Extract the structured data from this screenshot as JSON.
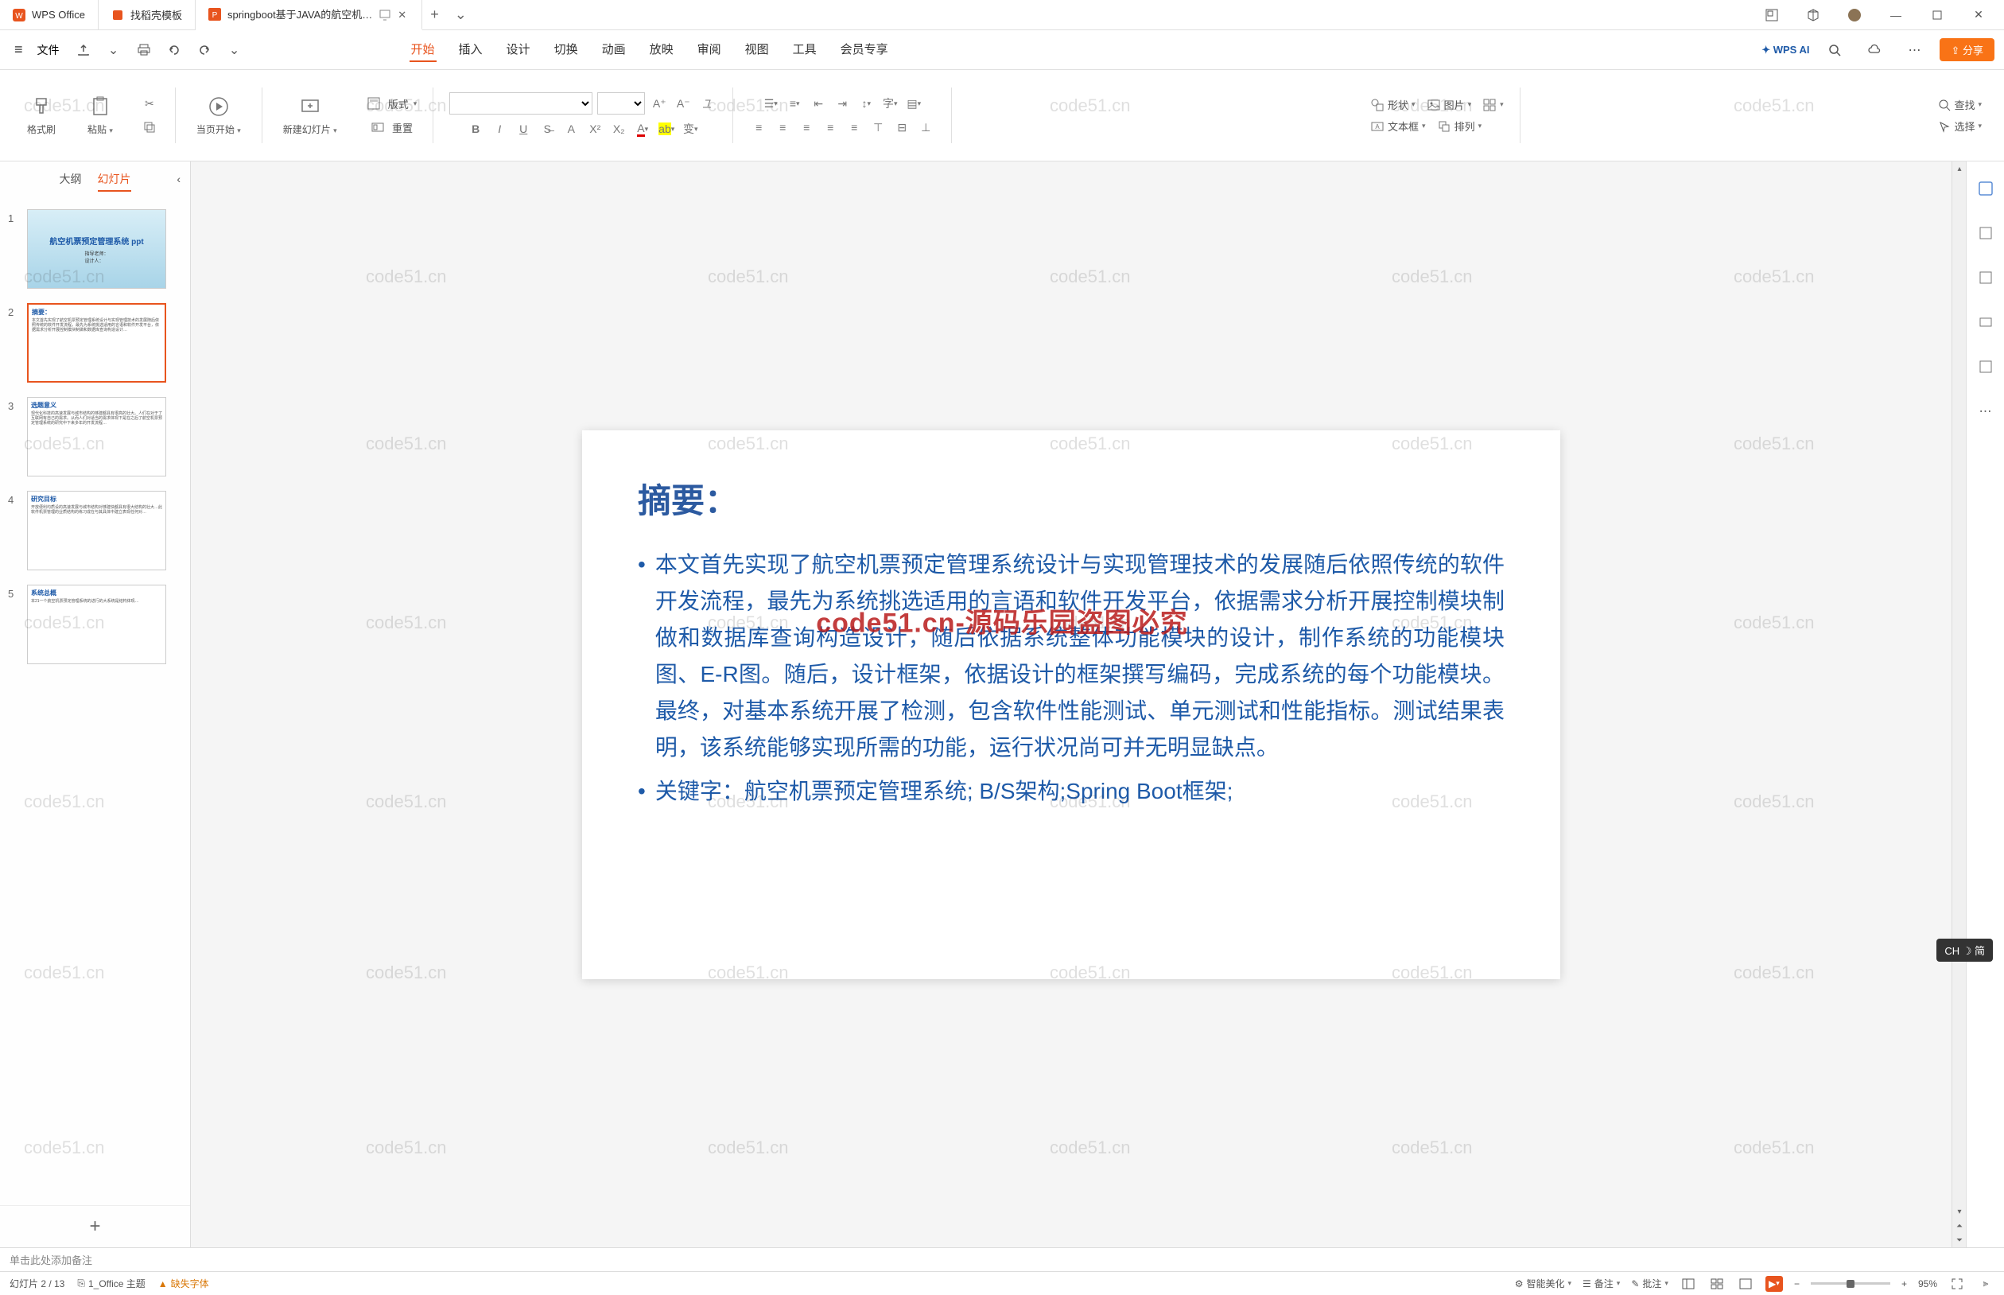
{
  "titlebar": {
    "app_name": "WPS Office",
    "tab1": "找稻壳模板",
    "tab2": "springboot基于JAVA的航空机…",
    "new_tab": "+",
    "dropdown": "⌄"
  },
  "menubar": {
    "file": "文件",
    "tabs": {
      "start": "开始",
      "insert": "插入",
      "design": "设计",
      "transition": "切换",
      "animation": "动画",
      "show": "放映",
      "review": "审阅",
      "view": "视图",
      "tools": "工具",
      "member": "会员专享"
    },
    "wps_ai": "WPS AI",
    "share": "分享"
  },
  "ribbon": {
    "format_painter": "格式刷",
    "paste": "粘贴",
    "from_current": "当页开始",
    "new_slide": "新建幻灯片",
    "layout": "版式",
    "reset": "重置",
    "shape": "形状",
    "picture": "图片",
    "textbox": "文本框",
    "arrange": "排列",
    "find": "查找",
    "select": "选择"
  },
  "sidebar": {
    "outline": "大纲",
    "slides": "幻灯片",
    "thumbs": [
      {
        "num": "1",
        "title": "航空机票预定管理系统 ppt",
        "sub": "指导老师：\n设计人："
      },
      {
        "num": "2",
        "title": "摘要：",
        "body": "本文首先实现了航空机票预定管理系统设计与实现管理技术的发展随后依照传统的软件开发流程，最先为系统挑选适用的言语和软件开发平台，依据需求分析开展控制模块制做和数据库查询构造设计…"
      },
      {
        "num": "3",
        "title": "选题意义",
        "body": ""
      },
      {
        "num": "4",
        "title": "研究目标",
        "body": ""
      },
      {
        "num": "5",
        "title": "系统总概",
        "body": ""
      }
    ],
    "add": "+"
  },
  "slide": {
    "title": "摘要：",
    "bullet1": "本文首先实现了航空机票预定管理系统设计与实现管理技术的发展随后依照传统的软件开发流程，最先为系统挑选适用的言语和软件开发平台，依据需求分析开展控制模块制做和数据库查询构造设计，随后依据系统整体功能模块的设计，制作系统的功能模块图、E-R图。随后，设计框架，依据设计的框架撰写编码，完成系统的每个功能模块。最终，对基本系统开展了检测，包含软件性能测试、单元测试和性能指标。测试结果表明，该系统能够实现所需的功能，运行状况尚可并无明显缺点。",
    "bullet2": "关键字：航空机票预定管理系统; B/S架构;Spring Boot框架;"
  },
  "notes": {
    "placeholder": "单击此处添加备注"
  },
  "statusbar": {
    "slide_count": "幻灯片 2 / 13",
    "theme": "1_Office 主题",
    "missing_font": "缺失字体",
    "beautify": "智能美化",
    "notes": "备注",
    "comments": "批注",
    "zoom": "95%"
  },
  "watermark": {
    "text": "code51.cn",
    "center": "code51.cn-源码乐园盗图必究"
  },
  "ime": {
    "badge": "CH ☽ 简"
  }
}
